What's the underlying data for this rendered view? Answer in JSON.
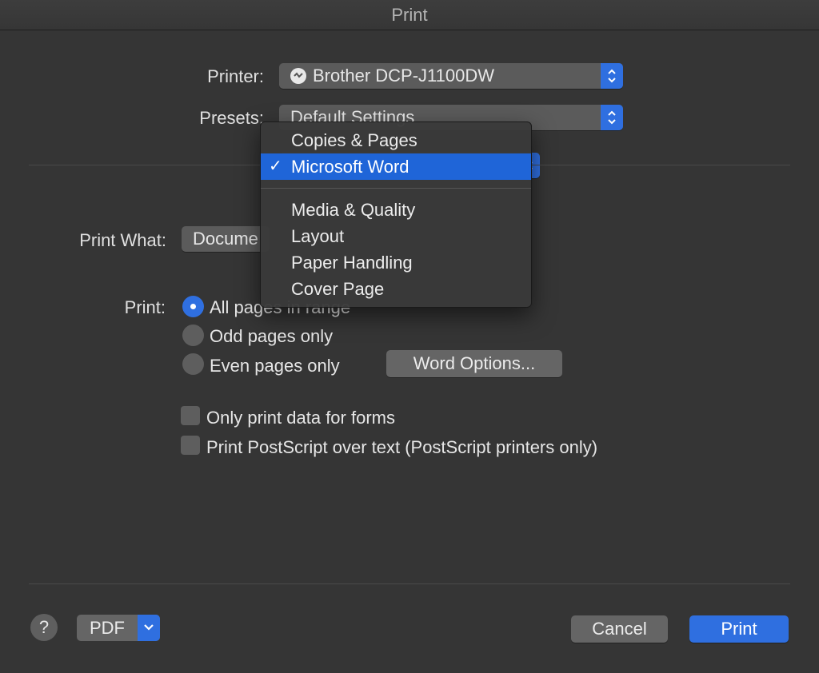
{
  "window": {
    "title": "Print"
  },
  "printer": {
    "label": "Printer:",
    "value": "Brother DCP-J1100DW"
  },
  "presets": {
    "label": "Presets:",
    "value": "Default Settings"
  },
  "print_what": {
    "label": "Print What:",
    "value": "Docume"
  },
  "print_range": {
    "label": "Print:",
    "options": [
      {
        "label": "All pages in range",
        "selected": true
      },
      {
        "label": "Odd pages only",
        "selected": false
      },
      {
        "label": "Even pages only",
        "selected": false
      }
    ]
  },
  "word_options_button": "Word Options...",
  "checkboxes": [
    {
      "label": "Only print data for forms",
      "checked": false
    },
    {
      "label": "Print PostScript over text (PostScript printers only)",
      "checked": false
    }
  ],
  "menu": {
    "items": [
      {
        "label": "Copies & Pages",
        "selected": false
      },
      {
        "label": "Microsoft Word",
        "selected": true
      },
      {
        "label": "Media & Quality",
        "selected": false
      },
      {
        "label": "Layout",
        "selected": false
      },
      {
        "label": "Paper Handling",
        "selected": false
      },
      {
        "label": "Cover Page",
        "selected": false
      }
    ]
  },
  "footer": {
    "help": "?",
    "pdf": "PDF",
    "cancel": "Cancel",
    "print": "Print"
  },
  "colors": {
    "accent": "#2f6fe0",
    "background": "#353535"
  },
  "icons": [
    "printer-icon",
    "stepper-icon",
    "checkmark-icon",
    "chevron-down-icon"
  ]
}
